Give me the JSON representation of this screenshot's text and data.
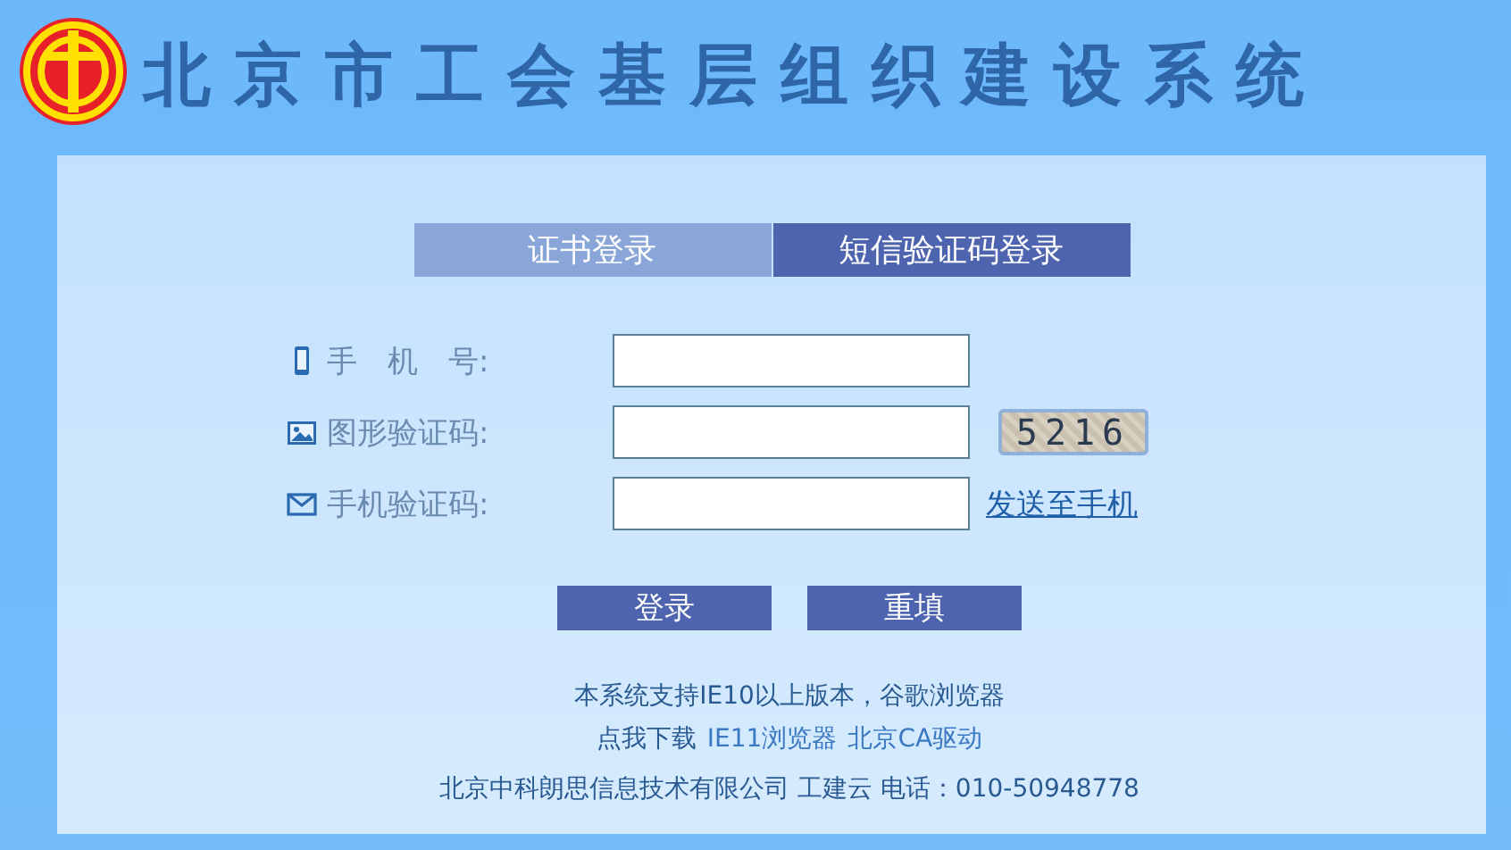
{
  "header": {
    "title": "北京市工会基层组织建设系统"
  },
  "tabs": [
    {
      "label": "证书登录",
      "selected": false
    },
    {
      "label": "短信验证码登录",
      "selected": true
    }
  ],
  "form": {
    "rows": [
      {
        "kind": "phone",
        "label": "手　机　号:"
      },
      {
        "kind": "captcha",
        "label": "图形验证码:",
        "captcha": "5216"
      },
      {
        "kind": "sms",
        "label": "手机验证码:",
        "link": "发送至手机"
      }
    ]
  },
  "buttons": [
    "登录",
    "重填"
  ],
  "footer": {
    "notice": "本系统支持IE10以上版本，谷歌浏览器",
    "download_label": "点我下载",
    "links": [
      "IE11浏览器",
      "北京CA驱动"
    ],
    "company": "北京中科朗思信息技术有限公司 工建云 电话：010-50948778"
  }
}
